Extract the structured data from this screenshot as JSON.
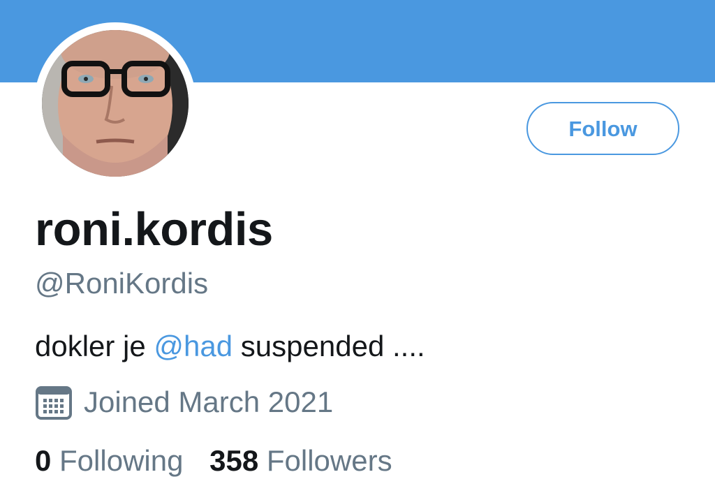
{
  "profile": {
    "display_name": "roni.kordis",
    "handle": "@RoniKordis",
    "avatar_description": "profile-photo",
    "bio": {
      "before": "dokler je ",
      "mention": "@had",
      "after": " suspended ...."
    },
    "joined": "Joined March 2021",
    "joined_icon": "calendar-icon"
  },
  "actions": {
    "follow_label": "Follow"
  },
  "stats": {
    "following_count": "0",
    "following_label": "Following",
    "followers_count": "358",
    "followers_label": "Followers"
  },
  "colors": {
    "banner": "#4a98e0",
    "accent": "#4a98e0",
    "text_primary": "#14171a",
    "text_secondary": "#657786"
  }
}
